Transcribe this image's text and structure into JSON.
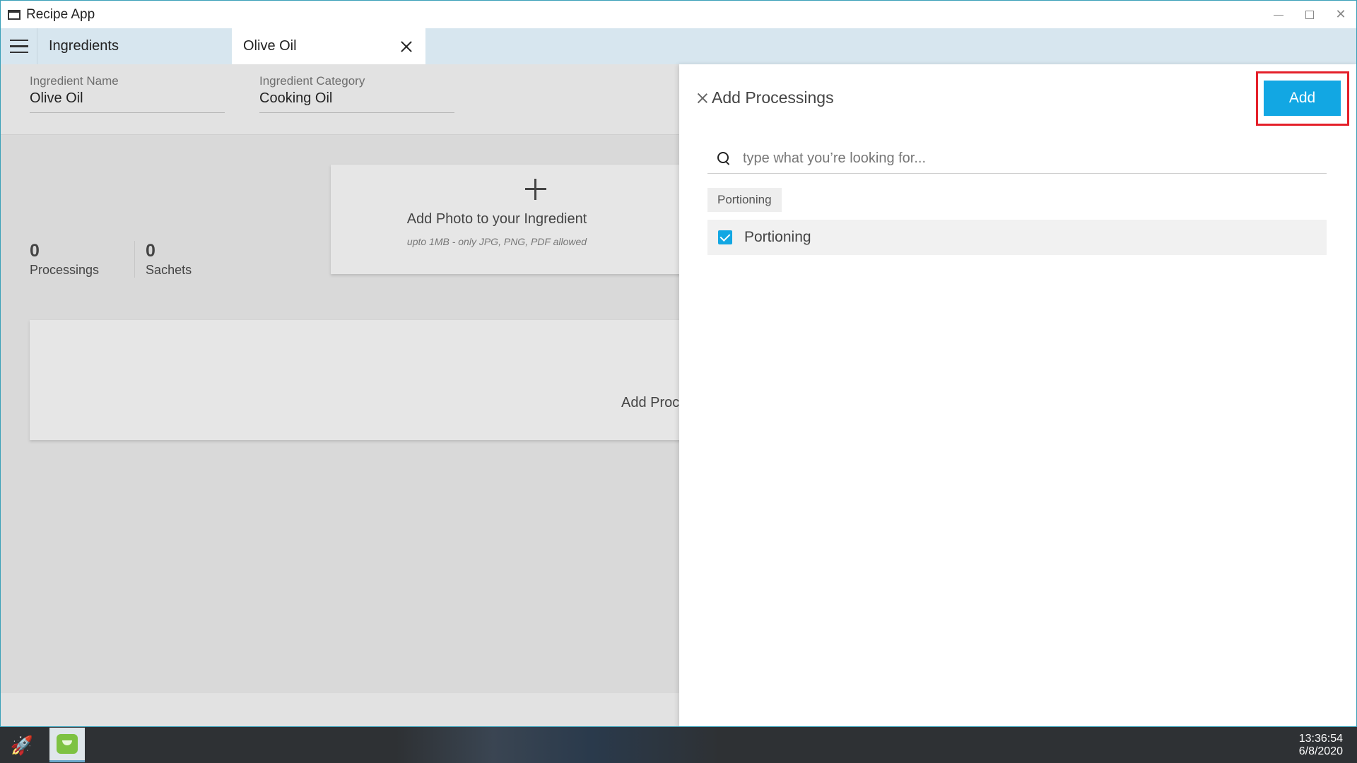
{
  "window": {
    "title": "Recipe App"
  },
  "tabs": [
    {
      "label": "Ingredients"
    },
    {
      "label": "Olive Oil"
    }
  ],
  "ingredient": {
    "name_label": "Ingredient Name",
    "name_value": "Olive Oil",
    "category_label": "Ingredient Category",
    "category_value": "Cooking Oil"
  },
  "stats": {
    "processings_count": "0",
    "processings_label": "Processings",
    "sachets_count": "0",
    "sachets_label": "Sachets"
  },
  "photo_card": {
    "title": "Add Photo to your Ingredient",
    "hint": "upto 1MB - only JPG, PNG, PDF allowed"
  },
  "processings_card": {
    "title": "Add Proc"
  },
  "drawer": {
    "title": "Add Processings",
    "add_label": "Add",
    "search_placeholder": "type what you’re looking for...",
    "group_label": "Portioning",
    "items": [
      {
        "label": "Portioning",
        "checked": true
      }
    ]
  },
  "taskbar": {
    "time": "13:36:54",
    "date": "6/8/2020"
  },
  "colors": {
    "accent": "#12a7e3",
    "highlight": "#e4202a",
    "tabbar": "#d7e6ef"
  },
  "icons": [
    "window-icon",
    "minimize-icon",
    "maximize-icon",
    "close-icon",
    "menu-icon",
    "search-icon",
    "plus-icon",
    "checkbox-checked-icon",
    "rocket-icon",
    "app-icon"
  ]
}
